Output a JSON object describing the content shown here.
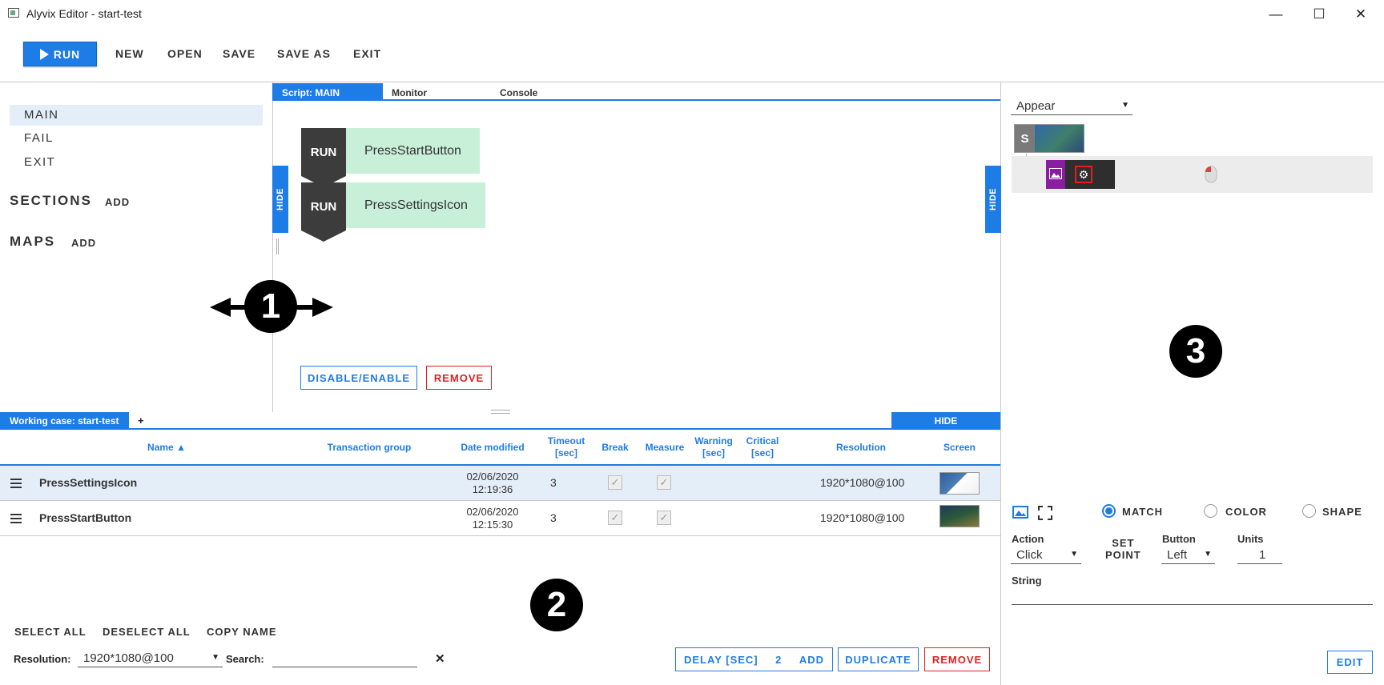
{
  "window": {
    "title": "Alyvix Editor - start-test",
    "minimize": "—",
    "maximize": "☐",
    "close": "✕"
  },
  "toolbar": {
    "run": "RUN",
    "items": [
      "NEW",
      "OPEN",
      "SAVE",
      "SAVE AS",
      "EXIT"
    ]
  },
  "nav": {
    "items": [
      "MAIN",
      "FAIL",
      "EXIT"
    ],
    "sections": "SECTIONS",
    "maps": "MAPS",
    "add": "ADD"
  },
  "script_tabs": [
    "Script: MAIN",
    "Monitor",
    "Console"
  ],
  "hide": "HIDE",
  "script_blocks": [
    {
      "run": "RUN",
      "name": "PressStartButton"
    },
    {
      "run": "RUN",
      "name": "PressSettingsIcon"
    }
  ],
  "script_buttons": {
    "disable_enable": "DISABLE/ENABLE",
    "remove": "REMOVE"
  },
  "annotations": [
    "1",
    "2",
    "3"
  ],
  "working_case": {
    "tab": "Working case: start-test",
    "plus": "+",
    "hide": "HIDE"
  },
  "table": {
    "headers": {
      "name": "Name ▲",
      "transaction_group": "Transaction group",
      "date_modified": "Date modified",
      "timeout": [
        "Timeout",
        "[sec]"
      ],
      "break": "Break",
      "measure": "Measure",
      "warning": [
        "Warning",
        "[sec]"
      ],
      "critical": [
        "Critical",
        "[sec]"
      ],
      "resolution": "Resolution",
      "screen": "Screen"
    },
    "rows": [
      {
        "name": "PressSettingsIcon",
        "date": "02/06/2020",
        "time": "12:19:36",
        "timeout": "3",
        "break": "✓",
        "measure": "✓",
        "resolution": "1920*1080@100"
      },
      {
        "name": "PressStartButton",
        "date": "02/06/2020",
        "time": "12:15:30",
        "timeout": "3",
        "break": "✓",
        "measure": "✓",
        "resolution": "1920*1080@100"
      }
    ]
  },
  "footer": {
    "select_all": "SELECT ALL",
    "deselect_all": "DESELECT ALL",
    "copy_name": "COPY NAME",
    "resolution_label": "Resolution:",
    "resolution_value": "1920*1080@100",
    "search_label": "Search:",
    "search_clear": "✕",
    "delay_label": "DELAY [SEC]",
    "delay_value": "2",
    "add": "ADD",
    "duplicate": "DUPLICATE",
    "remove": "REMOVE"
  },
  "right_panel": {
    "appear": "Appear",
    "tree_s": "S",
    "match": "MATCH",
    "color": "COLOR",
    "shape": "SHAPE",
    "action_label": "Action",
    "action_value": "Click",
    "set_point": [
      "SET",
      "POINT"
    ],
    "button_label": "Button",
    "button_value": "Left",
    "units_label": "Units",
    "units_value": "1",
    "string_label": "String",
    "edit": "EDIT"
  },
  "colors": {
    "accent": "#1e7ce6",
    "danger": "#e02020",
    "block_dark": "#3c3c3c",
    "block_green": "#c8efd8"
  }
}
